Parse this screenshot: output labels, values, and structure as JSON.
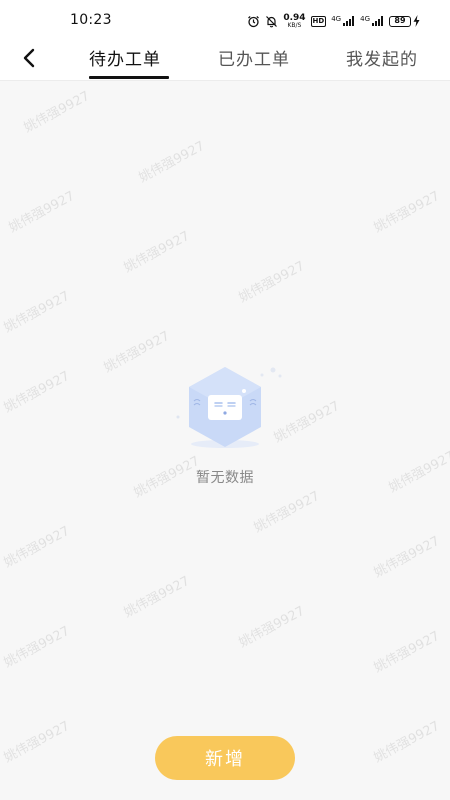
{
  "status_bar": {
    "time": "10:23",
    "net_speed_value": "0.94",
    "net_speed_unit": "KB/S",
    "hd_label": "HD",
    "sim1_label": "4G",
    "sim2_label": "4G",
    "battery_level": "89",
    "icons": [
      "alarm-icon",
      "mute-bell-icon",
      "signal-icon",
      "battery-icon",
      "charging-icon"
    ]
  },
  "nav": {
    "back_icon": "chevron-left-icon",
    "tabs": [
      {
        "label": "待办工单",
        "active": true
      },
      {
        "label": "已办工单",
        "active": false
      },
      {
        "label": "我发起的",
        "active": false
      }
    ]
  },
  "empty_state": {
    "icon": "empty-box-illustration",
    "text": "暂无数据"
  },
  "watermark": {
    "text": "姚伟强9927"
  },
  "add_button": {
    "label": "新增"
  },
  "colors": {
    "accent": "#f9c85b",
    "background": "#f7f7f7",
    "illustration": "#c9d9f7"
  }
}
